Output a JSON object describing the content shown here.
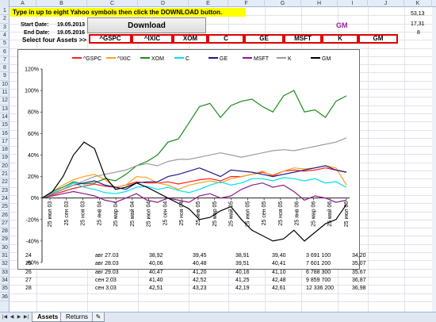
{
  "columns": [
    "A",
    "B",
    "C",
    "D",
    "E",
    "F",
    "G",
    "H",
    "I",
    "J",
    "K"
  ],
  "rows": [
    "1",
    "2",
    "3",
    "4",
    "5",
    "6",
    "7",
    "8",
    "9",
    "10",
    "11",
    "12",
    "13",
    "14",
    "15",
    "16",
    "17",
    "18",
    "19",
    "20",
    "21",
    "22",
    "23",
    "24",
    "25",
    "26",
    "27",
    "28",
    "29",
    "30",
    "31",
    "32",
    "33",
    "34",
    "35",
    "36"
  ],
  "banner_text": "Type in up to eight Yahoo symbols then click the DOWNLOAD button.",
  "start_label": "Start Date:",
  "start_value": "19.05.2013",
  "end_label": "End Date:",
  "end_value": "19.05.2016",
  "select_label": "Select four Assets >>",
  "download_label": "Download",
  "gm_label": "GM",
  "k_values": [
    "53,13",
    "17,31",
    "8"
  ],
  "symbols": [
    "^GSPC",
    "^IXIC",
    "XOM",
    "C",
    "GE",
    "MSFT",
    "K",
    "GM"
  ],
  "data_rows": [
    {
      "row": "31",
      "a": "24",
      "c": "авг 27.03",
      "d": "38,92",
      "e": "39,45",
      "f": "38,91",
      "g": "39,40",
      "h": "3 691 100",
      "i": "34,20"
    },
    {
      "row": "32",
      "a": "25",
      "c": "авг 28.03",
      "d": "40,06",
      "e": "40,48",
      "f": "39,51",
      "g": "40,41",
      "h": "7 601 200",
      "i": "35,07"
    },
    {
      "row": "33",
      "a": "26",
      "c": "авг 29.03",
      "d": "40,47",
      "e": "41,20",
      "f": "40,16",
      "g": "41,10",
      "h": "6 788 300",
      "i": "35,67"
    },
    {
      "row": "34",
      "a": "27",
      "c": "сен 2.03",
      "d": "41,40",
      "e": "42,52",
      "f": "41,25",
      "g": "42,48",
      "h": "9 859 700",
      "i": "36,87"
    },
    {
      "row": "35",
      "a": "28",
      "c": "сен 3.03",
      "d": "42,51",
      "e": "43,23",
      "f": "42,19",
      "g": "42,61",
      "h": "12 336 200",
      "i": "36,98"
    }
  ],
  "tabs": [
    "Assets",
    "Returns"
  ],
  "chart_data": {
    "type": "line",
    "legend_position": "top",
    "ylim": [
      -60,
      120
    ],
    "yticks": [
      "120%",
      "100%",
      "80%",
      "60%",
      "40%",
      "20%",
      "0%",
      "-20%",
      "-40%",
      "-60%"
    ],
    "ytick_values": [
      120,
      100,
      80,
      60,
      40,
      20,
      0,
      -20,
      -40,
      -60
    ],
    "xticks": [
      "25 июл 03",
      "25 сен 03",
      "25 ноя 03",
      "25 янв 04",
      "25 мар 04",
      "25 май 04",
      "25 июл 04",
      "25 сен 04",
      "25 ноя 04",
      "25 янв 05",
      "25 мар 05",
      "25 май 05",
      "25 июл 05",
      "25 сен 05",
      "25 ноя 05",
      "25 янв 06",
      "25 мар 06",
      "25 май 06",
      "25 июл 06"
    ],
    "grid": false,
    "series": [
      {
        "name": "^GSPC",
        "color": "#ff2020",
        "values": [
          0,
          3,
          6,
          9,
          11,
          13,
          11,
          10,
          12,
          15,
          14,
          14,
          15,
          13,
          15,
          17,
          18,
          16,
          20,
          20,
          22,
          24,
          21,
          25,
          26,
          25,
          26,
          28,
          26,
          24
        ]
      },
      {
        "name": "^IXIC",
        "color": "#ffa020",
        "values": [
          0,
          6,
          12,
          17,
          20,
          22,
          17,
          10,
          12,
          20,
          19,
          14,
          12,
          8,
          12,
          14,
          16,
          14,
          18,
          20,
          22,
          25,
          20,
          25,
          28,
          27,
          28,
          30,
          28,
          12
        ]
      },
      {
        "name": "XOM",
        "color": "#1a8c1a",
        "values": [
          0,
          6,
          10,
          15,
          13,
          14,
          18,
          16,
          22,
          30,
          34,
          40,
          52,
          55,
          70,
          85,
          88,
          75,
          86,
          90,
          92,
          85,
          80,
          95,
          100,
          80,
          82,
          75,
          90,
          95
        ]
      },
      {
        "name": "C",
        "color": "#00e0f0",
        "values": [
          0,
          5,
          8,
          14,
          10,
          8,
          5,
          4,
          6,
          10,
          11,
          8,
          10,
          7,
          5,
          8,
          12,
          15,
          12,
          14,
          18,
          18,
          16,
          19,
          18,
          16,
          18,
          14,
          15,
          10
        ]
      },
      {
        "name": "GE",
        "color": "#1a1a8c",
        "values": [
          0,
          4,
          8,
          12,
          14,
          16,
          12,
          10,
          8,
          14,
          15,
          15,
          20,
          22,
          25,
          28,
          24,
          20,
          26,
          25,
          24,
          22,
          20,
          22,
          24,
          26,
          28,
          30,
          26,
          24
        ]
      },
      {
        "name": "MSFT",
        "color": "#8c1a8c",
        "values": [
          0,
          2,
          4,
          6,
          4,
          2,
          -2,
          -4,
          0,
          4,
          -2,
          -4,
          0,
          -2,
          -4,
          2,
          4,
          0,
          2,
          8,
          12,
          14,
          10,
          12,
          6,
          -2,
          2,
          0,
          -4,
          -2
        ]
      },
      {
        "name": "K",
        "color": "#9c9c9c",
        "values": [
          0,
          4,
          8,
          12,
          16,
          20,
          22,
          24,
          26,
          30,
          32,
          30,
          34,
          36,
          36,
          38,
          40,
          42,
          40,
          38,
          40,
          42,
          44,
          45,
          44,
          46,
          48,
          50,
          52,
          56
        ]
      },
      {
        "name": "GM",
        "color": "#000000",
        "values": [
          0,
          6,
          20,
          40,
          52,
          46,
          20,
          8,
          10,
          14,
          10,
          5,
          0,
          -5,
          -10,
          -20,
          -18,
          -12,
          -8,
          -20,
          -30,
          -35,
          -40,
          -38,
          -30,
          -40,
          -32,
          -24,
          -20,
          -6
        ]
      }
    ]
  }
}
